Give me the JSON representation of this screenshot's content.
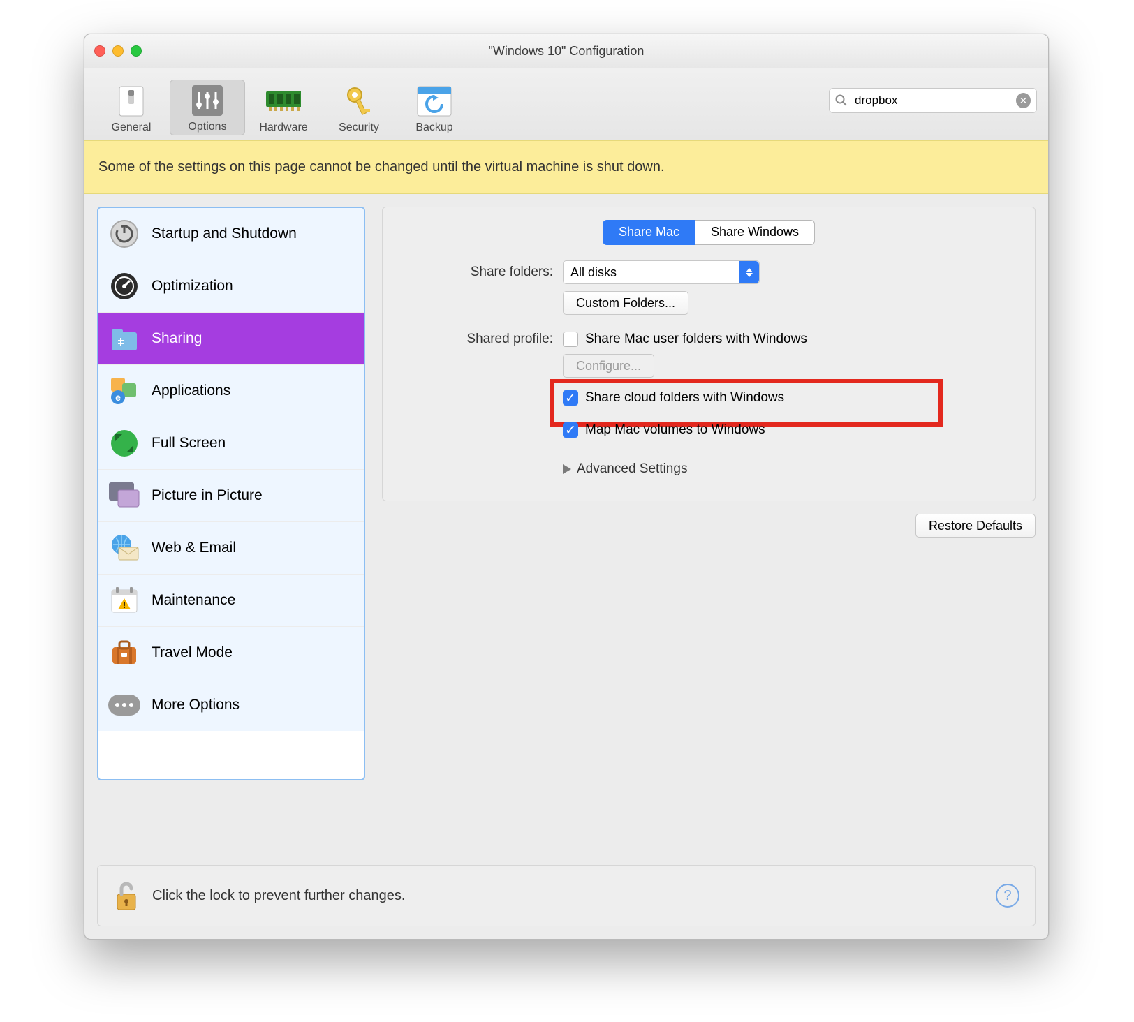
{
  "window": {
    "title": "\"Windows 10\" Configuration"
  },
  "toolbar": {
    "items": [
      {
        "label": "General"
      },
      {
        "label": "Options"
      },
      {
        "label": "Hardware"
      },
      {
        "label": "Security"
      },
      {
        "label": "Backup"
      }
    ],
    "search_value": "dropbox"
  },
  "banner": "Some of the settings on this page cannot be changed until the virtual machine is shut down.",
  "sidebar": {
    "items": [
      {
        "label": "Startup and Shutdown"
      },
      {
        "label": "Optimization"
      },
      {
        "label": "Sharing"
      },
      {
        "label": "Applications"
      },
      {
        "label": "Full Screen"
      },
      {
        "label": "Picture in Picture"
      },
      {
        "label": "Web & Email"
      },
      {
        "label": "Maintenance"
      },
      {
        "label": "Travel Mode"
      },
      {
        "label": "More Options"
      }
    ],
    "selected_index": 2
  },
  "tabs": {
    "share_mac": "Share Mac",
    "share_windows": "Share Windows"
  },
  "form": {
    "share_folders_label": "Share folders:",
    "share_folders_value": "All disks",
    "custom_folders_btn": "Custom Folders...",
    "shared_profile_label": "Shared profile:",
    "share_mac_user_folders": "Share Mac user folders with Windows",
    "configure_btn": "Configure...",
    "share_cloud": "Share cloud folders with Windows",
    "map_volumes": "Map Mac volumes to Windows",
    "advanced": "Advanced Settings"
  },
  "restore_defaults": "Restore Defaults",
  "footer": {
    "text": "Click the lock to prevent further changes."
  }
}
